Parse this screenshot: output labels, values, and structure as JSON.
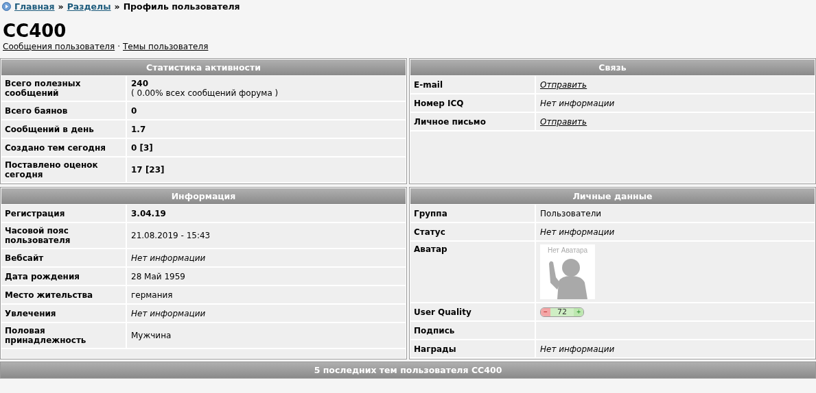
{
  "breadcrumb": {
    "links": [
      "Главная",
      "Разделы"
    ],
    "separator": "»",
    "current": "Профиль пользователя"
  },
  "username": "CC400",
  "user_links": [
    "Сообщения пользователя",
    "Темы пользователя"
  ],
  "links_separator": "·",
  "panels": [
    {
      "title": "Статистика активности",
      "rows": [
        {
          "label": "Всего полезных сообщений",
          "kind": "bold",
          "value": "240",
          "note": "( 0.00% всех сообщений форума )"
        },
        {
          "label": "Всего баянов",
          "kind": "bold",
          "value": "0"
        },
        {
          "label": "Сообщений в день",
          "kind": "bold",
          "value": "1.7"
        },
        {
          "label": "Создано тем сегодня",
          "kind": "bold",
          "value": "0 [3]"
        },
        {
          "label": "Поставлено оценок сегодня",
          "kind": "bold",
          "value": "17 [23]"
        }
      ]
    },
    {
      "title": "Связь",
      "rows": [
        {
          "label": "E-mail",
          "kind": "link",
          "value": "Отправить"
        },
        {
          "label": "Номер ICQ",
          "kind": "italic",
          "value": "Нет информации"
        },
        {
          "label": "Личное письмо",
          "kind": "link",
          "value": "Отправить"
        }
      ]
    },
    {
      "title": "Информация",
      "rows": [
        {
          "label": "Регистрация",
          "kind": "bold",
          "value": "3.04.19"
        },
        {
          "label": "Часовой пояс пользователя",
          "kind": "plain",
          "value": "21.08.2019 - 15:43"
        },
        {
          "label": "Вебсайт",
          "kind": "italic",
          "value": "Нет информации"
        },
        {
          "label": "Дата рождения",
          "kind": "plain",
          "value": "28 Май 1959"
        },
        {
          "label": "Место жительства",
          "kind": "plain",
          "value": "германия"
        },
        {
          "label": "Увлечения",
          "kind": "italic",
          "value": "Нет информации"
        },
        {
          "label": "Половая принадлежность",
          "kind": "plain",
          "value": "Мужчина"
        }
      ]
    },
    {
      "title": "Личные данные",
      "rows": [
        {
          "label": "Группа",
          "kind": "plain",
          "value": "Пользователи"
        },
        {
          "label": "Статус",
          "kind": "italic",
          "value": "Нет информации"
        },
        {
          "label": "Аватар",
          "kind": "avatar",
          "value": "Нет Аватара"
        },
        {
          "label": "User Quality",
          "kind": "quality",
          "value": "72",
          "minus": "−",
          "plus": "+"
        },
        {
          "label": "Подпись",
          "kind": "empty"
        },
        {
          "label": "Награды",
          "kind": "italic",
          "value": "Нет информации"
        }
      ]
    }
  ],
  "footer_title": "5 последних тем пользователя CC400"
}
